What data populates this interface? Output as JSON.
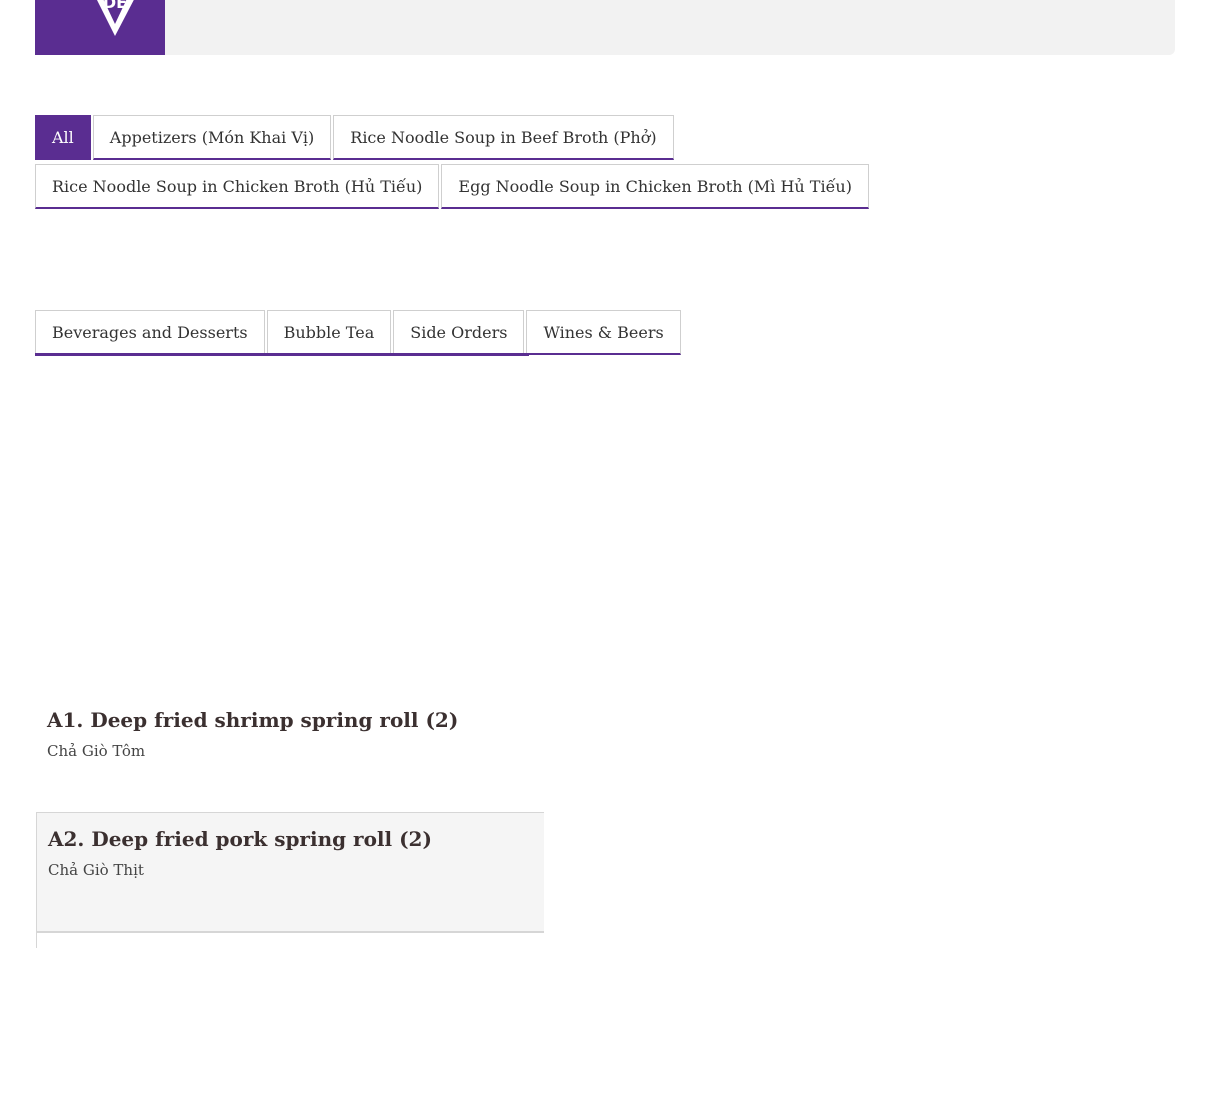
{
  "brand": {
    "accent_color": "#5a2d91",
    "logo_icon": "diamond-logo-icon",
    "logo_text": "DE"
  },
  "tabs_row1": [
    "All",
    "Appetizers (Món Khai Vị)",
    "Rice Noodle Soup in Beef Broth (Phở)"
  ],
  "tabs_row2": [
    "Rice Noodle Soup in Chicken Broth (Hủ Tiếu)",
    "Egg Noodle Soup in Chicken Broth (Mì Hủ Tiếu)"
  ],
  "tabs_row3": [
    "Beverages and Desserts",
    "Bubble Tea",
    "Side Orders",
    "Wines & Beers"
  ],
  "active_tab": "All",
  "items": [
    {
      "title": "A1. Deep fried shrimp spring roll (2)",
      "subtitle": "Chả Giò Tôm"
    },
    {
      "title": "A2. Deep fried pork spring roll (2)",
      "subtitle": "Chả Giò Thịt"
    }
  ]
}
